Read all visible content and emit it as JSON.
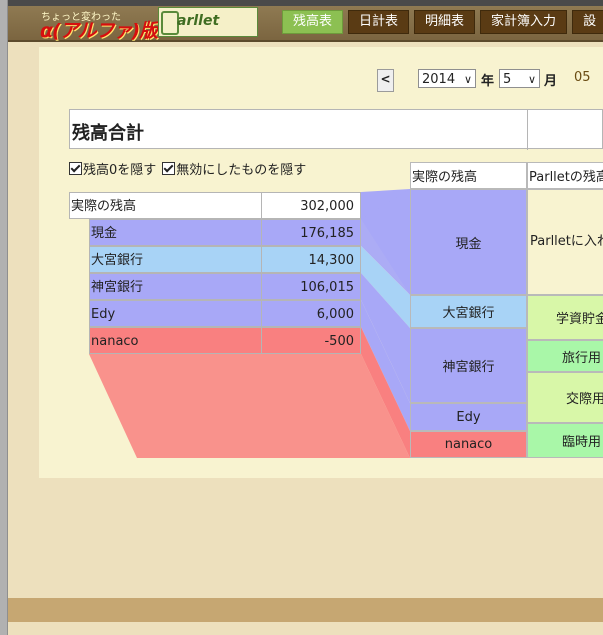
{
  "header": {
    "logo_tagline": "ちょっと変わった",
    "logo_title": "α(アルファ)版",
    "logo_product": "arllet"
  },
  "tabs": [
    {
      "label": "残高表",
      "active": true
    },
    {
      "label": "日計表",
      "active": false
    },
    {
      "label": "明細表",
      "active": false
    },
    {
      "label": "家計簿入力",
      "active": false
    },
    {
      "label": "設",
      "active": false
    }
  ],
  "nav": {
    "prev_label": "<",
    "year_value": "2014",
    "year_unit": "年",
    "month_value": "5",
    "month_unit": "月",
    "day_value": "05"
  },
  "summary_title": "残高合計",
  "filters": [
    {
      "label": "残高0を隠す",
      "checked": true
    },
    {
      "label": "無効にしたものを隠す",
      "checked": true
    }
  ],
  "actual_balance": {
    "label": "実際の残高",
    "value": "302,000"
  },
  "accounts": [
    {
      "name": "現金",
      "value": "176,185",
      "color": "#a8a8f7"
    },
    {
      "name": "大宮銀行",
      "value": "14,300",
      "color": "#a8d3f6"
    },
    {
      "name": "神宮銀行",
      "value": "106,015",
      "color": "#a8a8f7"
    },
    {
      "name": "Edy",
      "value": "6,000",
      "color": "#a8a8f7"
    },
    {
      "name": "nanaco",
      "value": "-500",
      "color": "#f98080"
    }
  ],
  "right_table": {
    "col1_header": "実際の残高",
    "col2_header": "Parlletの残高",
    "col1_cells": [
      {
        "label": "現金",
        "color": "#a8a8f7"
      },
      {
        "label": "大宮銀行",
        "color": "#a8d3f6"
      },
      {
        "label": "神宮銀行",
        "color": "#a8a8f7"
      },
      {
        "label": "Edy",
        "color": "#a8a8f7"
      },
      {
        "label": "nanaco",
        "color": "#f98080"
      }
    ],
    "col2_cells": [
      {
        "label": "Parlletに入れていないお金",
        "color": "#f8f3d0"
      },
      {
        "label": "学資貯金",
        "color": "#d8f7a8"
      },
      {
        "label": "旅行用",
        "color": "#a9f7a8"
      },
      {
        "label": "交際用",
        "color": "#d8f7a8"
      },
      {
        "label": "臨時用",
        "color": "#a9f7a8"
      }
    ]
  }
}
